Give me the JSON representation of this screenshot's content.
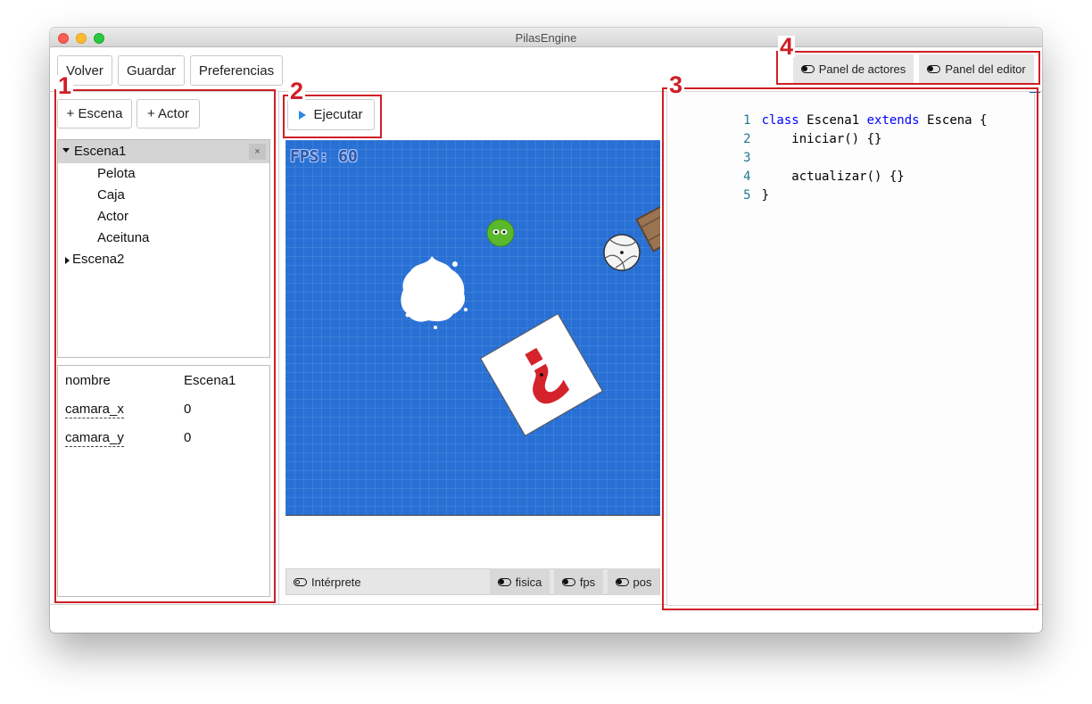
{
  "window": {
    "title": "PilasEngine"
  },
  "toolbar": {
    "volver": "Volver",
    "guardar": "Guardar",
    "preferencias": "Preferencias"
  },
  "panel_toggles": {
    "actores": "Panel de actores",
    "editor": "Panel del editor"
  },
  "annotations": [
    "1",
    "2",
    "3",
    "4"
  ],
  "actors_panel": {
    "add_scene": "+ Escena",
    "add_actor": "+ Actor",
    "tree": {
      "scene1": "Escena1",
      "scene1_close": "×",
      "actors": [
        "Pelota",
        "Caja",
        "Actor",
        "Aceituna"
      ],
      "scene2": "Escena2"
    },
    "properties": [
      {
        "name": "nombre",
        "value": "Escena1"
      },
      {
        "name": "camara_x",
        "value": "0"
      },
      {
        "name": "camara_y",
        "value": "0"
      }
    ]
  },
  "runner": {
    "run_label": "Ejecutar",
    "fps_label": "FPS: 60"
  },
  "bottom_bar": {
    "interpreter": "Intérprete",
    "fisica": "fisica",
    "fps": "fps",
    "pos": "pos"
  },
  "editor": {
    "lines": [
      {
        "n": "1",
        "a": "class",
        "b": " Escena1 ",
        "c": "extends",
        "d": " Escena {"
      },
      {
        "n": "2",
        "a": "",
        "b": "    iniciar() {}",
        "c": "",
        "d": ""
      },
      {
        "n": "3",
        "a": "",
        "b": "",
        "c": "",
        "d": ""
      },
      {
        "n": "4",
        "a": "",
        "b": "    actualizar() {}",
        "c": "",
        "d": ""
      },
      {
        "n": "5",
        "a": "",
        "b": "}",
        "c": "",
        "d": ""
      }
    ]
  },
  "colors": {
    "annotation_red": "#cf1f26",
    "stage_blue": "#2870d4",
    "ground": "#414141",
    "keyword": "#0000ff",
    "line_number": "#237893"
  }
}
